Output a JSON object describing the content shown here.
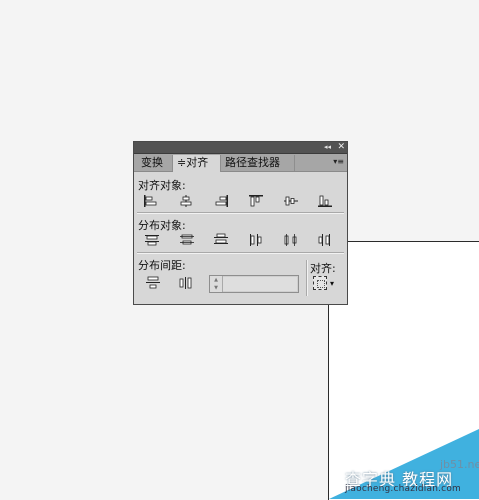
{
  "panel": {
    "titlebar": {
      "collapse_glyph": "◂◂",
      "close_glyph": "✕"
    },
    "tabs": [
      {
        "label": "变换",
        "active": false
      },
      {
        "label": "≑对齐",
        "active": true
      },
      {
        "label": "路径查找器",
        "active": false
      }
    ],
    "menu_glyph": "▾≡",
    "align_objects": {
      "label": "对齐对象:",
      "buttons": [
        "horizontal-align-left",
        "horizontal-align-center",
        "horizontal-align-right",
        "vertical-align-top",
        "vertical-align-center",
        "vertical-align-bottom"
      ]
    },
    "distribute_objects": {
      "label": "分布对象:",
      "buttons": [
        "vertical-distribute-top",
        "vertical-distribute-center",
        "vertical-distribute-bottom",
        "horizontal-distribute-left",
        "horizontal-distribute-center",
        "horizontal-distribute-right"
      ]
    },
    "distribute_spacing": {
      "label": "分布间距:",
      "buttons": [
        "vertical-distribute-space",
        "horizontal-distribute-space"
      ],
      "spacing_value": ""
    },
    "align_to": {
      "label": "对齐:",
      "caret": "▾"
    }
  },
  "watermark": {
    "line1": "查字典 教程网",
    "line2": "jb51.net",
    "line3": "jiaocheng.chazidian.com"
  },
  "colors": {
    "panel_bg": "#d7d7d7",
    "titlebar": "#535353",
    "tabbar": "#a6a6a6",
    "watermark": "#1fa3d9"
  }
}
